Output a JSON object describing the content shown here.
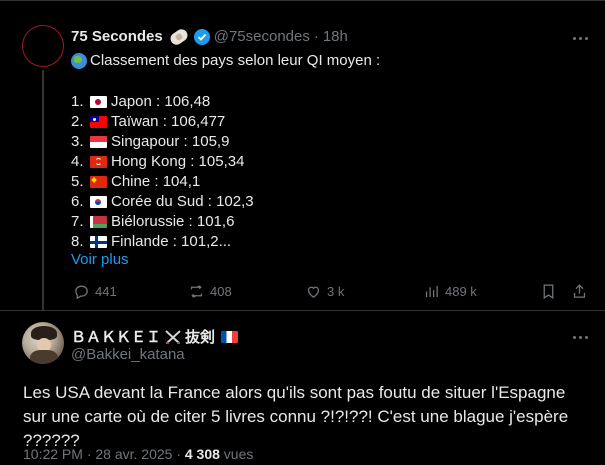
{
  "tweet": {
    "author_name": "75 Secondes",
    "emoji_after_name": "bandage-icon",
    "handle": "@75secondes",
    "separator": "·",
    "time": "18h",
    "intro": "Classement des pays selon leur QI moyen :",
    "ranking": [
      {
        "num": "1.",
        "flag": "japan",
        "text": "Japon : 106,48"
      },
      {
        "num": "2.",
        "flag": "taiwan",
        "text": "Taïwan : 106,477"
      },
      {
        "num": "3.",
        "flag": "singapore",
        "text": "Singapour : 105,9"
      },
      {
        "num": "4.",
        "flag": "hong-kong",
        "text": "Hong Kong : 105,34"
      },
      {
        "num": "5.",
        "flag": "china",
        "text": "Chine : 104,1"
      },
      {
        "num": "6.",
        "flag": "south-korea",
        "text": "Corée du Sud : 102,3"
      },
      {
        "num": "7.",
        "flag": "belarus",
        "text": "Biélorussie : 101,6"
      },
      {
        "num": "8.",
        "flag": "finland",
        "text": "Finlande : 101,2..."
      }
    ],
    "show_more": "Voir plus",
    "stats": {
      "replies": "441",
      "retweets": "408",
      "likes": "3 k",
      "views": "489 k"
    }
  },
  "reply": {
    "author_name": "ＢＡＫＫＥＩ",
    "name_suffix": "抜剣",
    "handle": "@Bakkei_katana",
    "text": "Les USA devant la France alors qu'ils sont pas foutu de situer l'Espagne sur une carte où de citer 5 livres connu ?!?!??! C'est une blague j'espère ??????",
    "timestamp": "10:22 PM · 28 avr. 2025 · ",
    "views_count": "4 308",
    "views_label": " vues"
  },
  "colors": {
    "background": "#000000",
    "text": "#e7e9ea",
    "muted": "#71767b",
    "link": "#1d9bf0",
    "border": "#2f3336"
  }
}
